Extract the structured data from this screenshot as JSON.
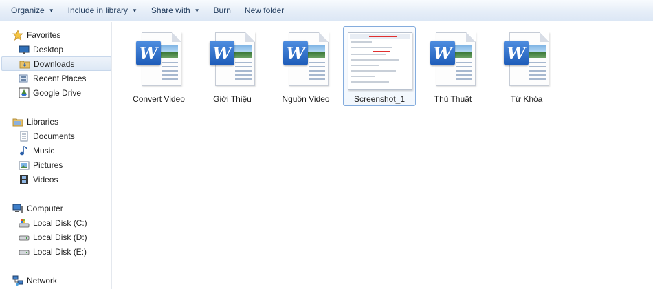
{
  "toolbar": {
    "organize": "Organize",
    "include_in_library": "Include in library",
    "share_with": "Share with",
    "burn": "Burn",
    "new_folder": "New folder"
  },
  "nav": {
    "favorites": "Favorites",
    "desktop": "Desktop",
    "downloads": "Downloads",
    "recent_places": "Recent Places",
    "google_drive": "Google Drive",
    "libraries": "Libraries",
    "documents": "Documents",
    "music": "Music",
    "pictures": "Pictures",
    "videos": "Videos",
    "computer": "Computer",
    "local_disk_c": "Local Disk (C:)",
    "local_disk_d": "Local Disk (D:)",
    "local_disk_e": "Local Disk (E:)",
    "network": "Network"
  },
  "files": [
    {
      "label": "Convert Video",
      "icon": "word-document-icon"
    },
    {
      "label": "Giới Thiệu",
      "icon": "word-document-icon"
    },
    {
      "label": "Nguồn Video",
      "icon": "word-document-icon"
    },
    {
      "label": "Screenshot_1",
      "icon": "image-thumbnail"
    },
    {
      "label": "Thủ Thuật",
      "icon": "word-document-icon"
    },
    {
      "label": "Từ Khóa",
      "icon": "word-document-icon"
    }
  ],
  "selected_file": "Screenshot_1",
  "colors": {
    "selection_border": "#84acdd",
    "toolbar_text": "#1e395b",
    "word_blue": "#1d5bb8"
  }
}
